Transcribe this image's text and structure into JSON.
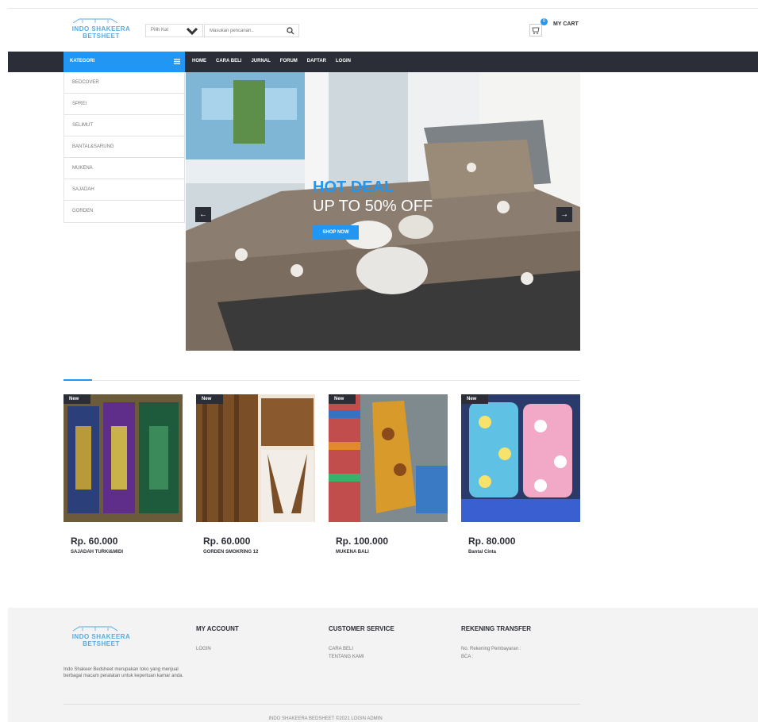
{
  "header": {
    "logo_text": "INDO SHAKEERA BETSHEET",
    "category_select": "Pilih Kat",
    "search_placeholder": "Masukan pencarian..",
    "cart_label": "MY CART",
    "cart_count": "0"
  },
  "nav": {
    "category_heading": "KATEGORI",
    "links": [
      "HOME",
      "CARA BELI",
      "JURNAL",
      "FORUM",
      "DAFTAR",
      "LOGIN"
    ]
  },
  "categories": [
    "BEDCOVER",
    "SPREI",
    "SELIMUT",
    "BANTAL&SARUNG",
    "MUKENA",
    "SAJADAH",
    "GORDEN"
  ],
  "hero": {
    "title_accent": "HOT DEAL",
    "title_main": "UP TO 50% OFF",
    "button": "SHOP NOW"
  },
  "products": [
    {
      "badge": "New",
      "price": "Rp. 60.000",
      "name": "SAJADAH TURKI&MIDI"
    },
    {
      "badge": "New",
      "price": "Rp. 60.000",
      "name": "GORDEN SMOKRING 12"
    },
    {
      "badge": "New",
      "price": "Rp. 100.000",
      "name": "MUKENA BALI"
    },
    {
      "badge": "New",
      "price": "Rp. 80.000",
      "name": "Bantal Cinta"
    }
  ],
  "footer": {
    "logo_text": "INDO SHAKEERA BETSHEET",
    "description": "Indo Shakeer Bedsheet merupakan toko yang menjual berbagai macam peralatan untuk kepertuan kamar anda.",
    "my_account": {
      "heading": "MY ACCOUNT",
      "links": [
        "LOGIN"
      ]
    },
    "customer_service": {
      "heading": "CUSTOMER SERVICE",
      "links": [
        "CARA BELI",
        "TENTANG KAMI"
      ]
    },
    "rekening": {
      "heading": "REKENING TRANSFER",
      "links": [
        "No. Rekening Pembayaran :",
        "BCA :"
      ]
    },
    "copyright": "INDO SHAKEERA BEDSHEET ©2021 LOGIN ADMIN"
  },
  "colors": {
    "accent": "#2196f3",
    "navbar": "#2b2e37",
    "footer_bg": "#f3f3f3"
  }
}
